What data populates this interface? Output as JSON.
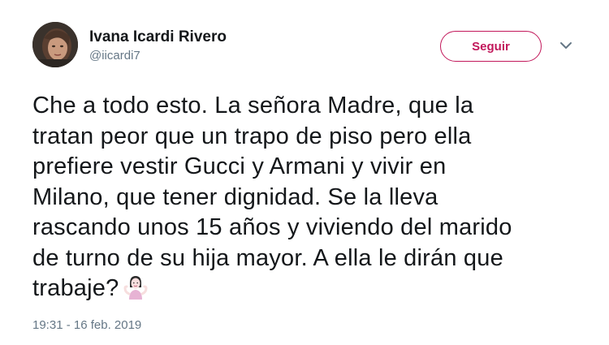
{
  "user": {
    "display_name": "Ivana Icardi Rivero",
    "handle": "@iicardi7"
  },
  "follow_button": {
    "label": "Seguir"
  },
  "tweet": {
    "lines": [
      "Che a todo esto. La señora Madre, que la",
      "tratan peor que un trapo de piso pero ella",
      "prefiere vestir Gucci y Armani y vivir en",
      "Milano, que tener dignidad. Se la lleva",
      "rascando unos 15 años y viviendo del marido",
      "de turno de su hija mayor. A ella le dirán que",
      "trabaje?"
    ],
    "emoji": "person-shrugging-emoji",
    "timestamp": "19:31 - 16 feb. 2019"
  },
  "icons": {
    "caret": "chevron-down-icon",
    "avatar": "user-avatar"
  },
  "colors": {
    "accent": "#c2185b",
    "text": "#14171a",
    "secondary_text": "#657786",
    "background": "#ffffff"
  }
}
